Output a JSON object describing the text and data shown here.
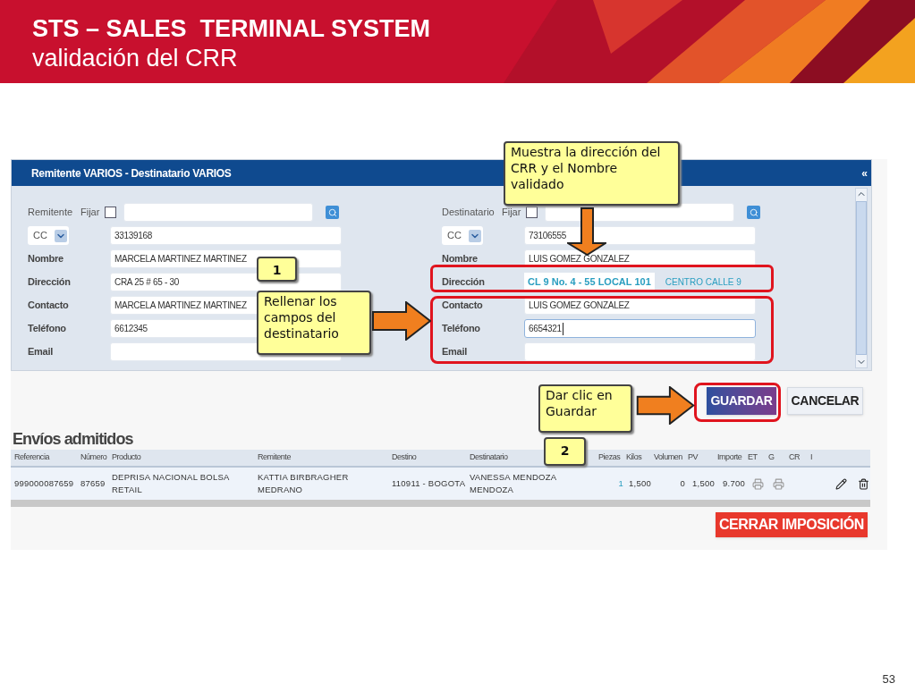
{
  "slide": {
    "title": "STS – SALES  TERMINAL SYSTEM",
    "subtitle": "validación del CRR",
    "page_number": "53"
  },
  "form": {
    "title": "Remitente VARIOS - Destinatario VARIOS",
    "collapse_icon": "«",
    "parties": [
      {
        "label": "Remitente",
        "fix_label": "Fijar",
        "fix_checked": false,
        "doc_type": "CC",
        "doc_number": "33139168",
        "fields": [
          {
            "kind": "input",
            "label": "Nombre",
            "value": "MARCELA MARTINEZ MARTINEZ",
            "focused": false
          },
          {
            "kind": "input",
            "label": "Dirección",
            "value": "CRA 25 # 65 - 30",
            "focused": false
          },
          {
            "kind": "input",
            "label": "Contacto",
            "value": "MARCELA MARTINEZ MARTINEZ",
            "focused": false
          },
          {
            "kind": "input",
            "label": "Teléfono",
            "value": "6612345",
            "focused": false
          },
          {
            "kind": "input",
            "label": "Email",
            "focused": false
          }
        ]
      },
      {
        "label": "Destinatario",
        "fix_label": "Fijar",
        "fix_checked": false,
        "doc_type": "CC",
        "doc_number": "73106555",
        "fields": [
          {
            "kind": "input",
            "label": "Nombre",
            "value": "LUIS GOMEZ GONZALEZ",
            "focused": false
          },
          {
            "kind": "validated",
            "label": "Dirección",
            "value": "CL 9 No. 4 - 55 LOCAL 101",
            "locality": "CENTRO CALLE 9"
          },
          {
            "kind": "input",
            "label": "Contacto",
            "value": "LUIS GOMEZ GONZALEZ",
            "focused": false
          },
          {
            "kind": "input",
            "label": "Teléfono",
            "value": "6654321",
            "focused": true
          },
          {
            "kind": "input",
            "label": "Email",
            "focused": false
          }
        ]
      }
    ]
  },
  "actions": [
    {
      "label": "GUARDAR",
      "kind": "primary"
    },
    {
      "label": "CANCELAR",
      "kind": "secondary"
    }
  ],
  "shipments": {
    "title": "Envíos admitidos",
    "columns": [
      "Referencia",
      "Número",
      "Producto",
      "Remitente",
      "Destino",
      "Destinatario",
      "Piezas",
      "Kilos",
      "Volumen",
      "PV",
      "Importe",
      "ET",
      "G",
      "CR",
      "I"
    ],
    "rows": [
      {
        "cells": [
          "999000087659",
          "87659",
          "DEPRISA NACIONAL BOLSA RETAIL",
          "KATTIA BIRBRAGHER MEDRANO",
          "110911 - BOGOTA",
          "VANESSA MENDOZA MENDOZA",
          "1",
          "1,500",
          "0",
          "1,500",
          "9.700"
        ]
      }
    ]
  },
  "close_button": "CERRAR IMPOSICIÓN",
  "callouts": [
    {
      "text": "Muestra la dirección del CRR y el Nombre validado",
      "kind": "down"
    },
    {
      "text": "1",
      "kind": "plain"
    },
    {
      "text": "Rellenar los campos del destinatario",
      "kind": "right"
    },
    {
      "text": "Dar clic en Guardar",
      "kind": "right"
    },
    {
      "text": "2",
      "kind": "plain"
    }
  ]
}
